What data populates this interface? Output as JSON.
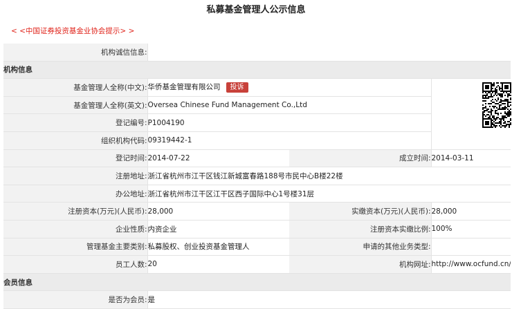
{
  "page": {
    "title": "私募基金管理人公示信息",
    "hint": "< <中国证券投资基金业协会提示> >"
  },
  "integrity": {
    "label": "机构诚信信息:",
    "value": ""
  },
  "org_section": {
    "title": "机构信息"
  },
  "fields": {
    "name_cn_label": "基金管理人全称(中文):",
    "name_cn_value": "华侨基金管理有限公司",
    "complaint_label": "投诉",
    "name_en_label": "基金管理人全称(英文):",
    "name_en_value": "Oversea Chinese Fund Management Co.,Ltd",
    "reg_no_label": "登记编号:",
    "reg_no_value": "P1004190",
    "org_code_label": "组织机构代码:",
    "org_code_value": "09319442-1",
    "reg_time_label": "登记时间:",
    "reg_time_value": "2014-07-22",
    "found_time_label": "成立时间:",
    "found_time_value": "2014-03-11",
    "reg_addr_label": "注册地址:",
    "reg_addr_value": "浙江省杭州市江干区钱江新城富春路188号市民中心B楼22楼",
    "office_addr_label": "办公地址:",
    "office_addr_value": "浙江省杭州市江干区江干区西子国际中心1号楼31层",
    "reg_capital_label": "注册资本(万元)(人民币):",
    "reg_capital_value": "28,000",
    "paid_capital_label": "实缴资本(万元)(人民币):",
    "paid_capital_value": "28,000",
    "nature_label": "企业性质:",
    "nature_value": "内资企业",
    "paid_ratio_label": "注册资本实缴比例:",
    "paid_ratio_value": "100%",
    "fund_type_label": "管理基金主要类别:",
    "fund_type_value": "私募股权、创业投资基金管理人",
    "other_biz_label": "申请的其他业务类型:",
    "other_biz_value": "",
    "staff_label": "员工人数:",
    "staff_value": "20",
    "website_label": "机构网址:",
    "website_value": "http://www.ocfund.cn/"
  },
  "member_section": {
    "title": "会员信息"
  },
  "member": {
    "is_member_label": "是否为会员:",
    "is_member_value": "是"
  },
  "colors": {
    "accent_red": "#e0241b",
    "badge_red": "#c8413a",
    "link_blue": "#1a3c9c"
  },
  "icons": {
    "qr": "qr-code-icon"
  }
}
